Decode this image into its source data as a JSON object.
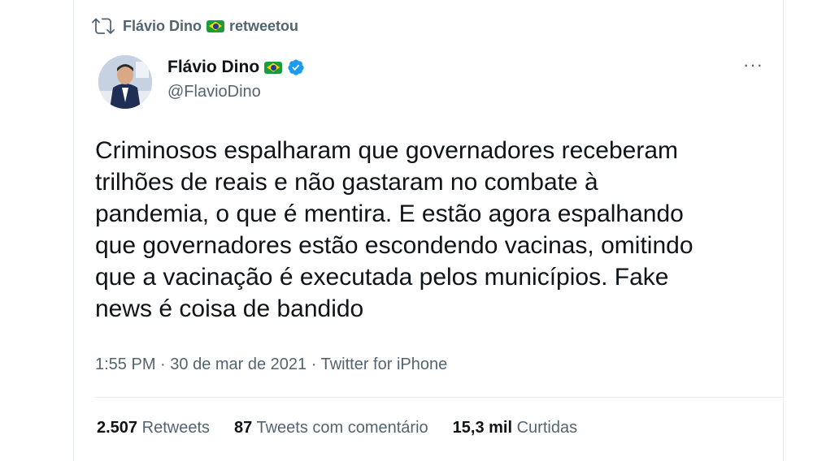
{
  "retweet_header": {
    "retweeter": "Flávio Dino",
    "action": "retweetou"
  },
  "author": {
    "name": "Flávio Dino",
    "handle": "@FlavioDino"
  },
  "more_label": "···",
  "tweet": {
    "text": "Criminosos espalharam que governadores receberam\ntrilhões de reais e não gastaram no combate à\npandemia, o que é mentira. E estão agora espalhando\nque governadores estão escondendo vacinas, omitindo\nque a vacinação é executada pelos municípios. Fake\nnews é coisa de bandido",
    "time": "1:55 PM",
    "date": "30 de mar de 2021",
    "source": "Twitter for iPhone"
  },
  "stats": {
    "retweets_count": "2.507",
    "retweets_label": "Retweets",
    "quotes_count": "87",
    "quotes_label": "Tweets com comentário",
    "likes_count": "15,3 mil",
    "likes_label": "Curtidas"
  },
  "colors": {
    "verified": "#1d9bf0",
    "secondary": "#536471",
    "text": "#0f1419"
  }
}
